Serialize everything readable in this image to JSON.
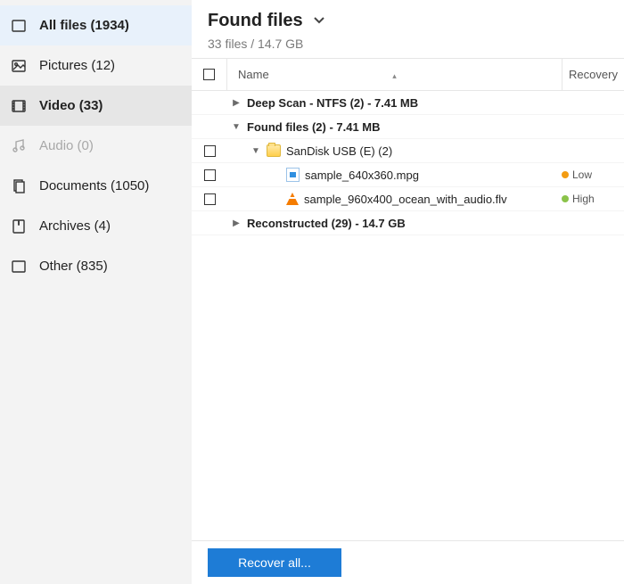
{
  "sidebar": {
    "items": [
      {
        "label": "All files (1934)",
        "state": "highlight"
      },
      {
        "label": "Pictures (12)",
        "state": ""
      },
      {
        "label": "Video (33)",
        "state": "selected"
      },
      {
        "label": "Audio (0)",
        "state": "disabled"
      },
      {
        "label": "Documents (1050)",
        "state": ""
      },
      {
        "label": "Archives (4)",
        "state": ""
      },
      {
        "label": "Other (835)",
        "state": ""
      }
    ]
  },
  "header": {
    "title": "Found files",
    "subtitle": "33 files / 14.7 GB"
  },
  "table": {
    "columns": {
      "name": "Name",
      "recovery": "Recovery"
    },
    "rows": [
      {
        "checkbox": false,
        "arrow": "right",
        "indent": 0,
        "bold": true,
        "label": "Deep Scan - NTFS (2) - 7.41 MB"
      },
      {
        "checkbox": false,
        "arrow": "down",
        "indent": 0,
        "bold": true,
        "label": "Found files (2) - 7.41 MB"
      },
      {
        "checkbox": true,
        "arrow": "down",
        "indent": 1,
        "bold": false,
        "icon": "folder",
        "label": "SanDisk USB (E) (2)"
      },
      {
        "checkbox": true,
        "arrow": "",
        "indent": 2,
        "bold": false,
        "icon": "mpg",
        "label": "sample_640x360.mpg",
        "recovery": "Low",
        "dot": "orange"
      },
      {
        "checkbox": true,
        "arrow": "",
        "indent": 2,
        "bold": false,
        "icon": "vlc",
        "label": "sample_960x400_ocean_with_audio.flv",
        "recovery": "High",
        "dot": "green"
      },
      {
        "checkbox": false,
        "arrow": "right",
        "indent": 0,
        "bold": true,
        "label": "Reconstructed (29) - 14.7 GB"
      }
    ]
  },
  "footer": {
    "recover_label": "Recover all..."
  }
}
